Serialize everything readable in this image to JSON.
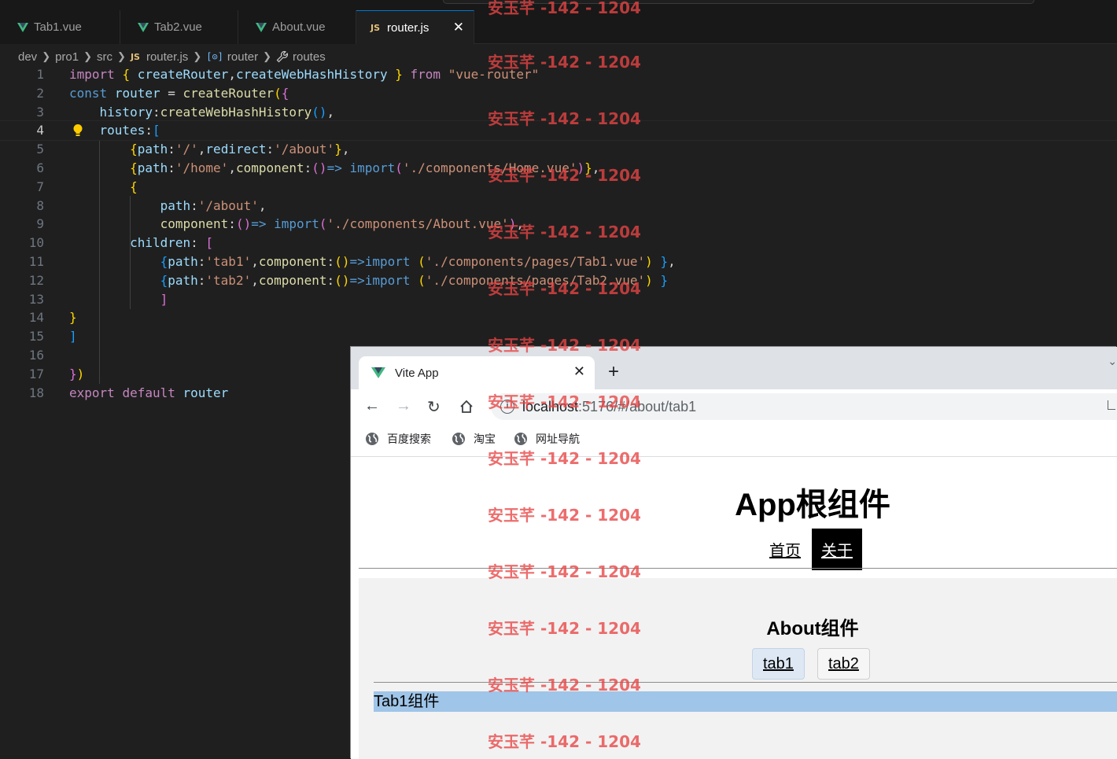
{
  "editor": {
    "tabs": [
      {
        "label": "Tab1.vue",
        "icon": "vue-icon"
      },
      {
        "label": "Tab2.vue",
        "icon": "vue-icon"
      },
      {
        "label": "About.vue",
        "icon": "vue-icon"
      },
      {
        "label": "router.js",
        "icon": "js-icon",
        "active": true
      }
    ],
    "breadcrumb": [
      "dev",
      "pro1",
      "src",
      "router.js",
      "router",
      "routes"
    ],
    "js_badge": "JS",
    "current_line": 4,
    "code_lines": [
      "1",
      "2",
      "3",
      "4",
      "5",
      "6",
      "7",
      "8",
      "9",
      "10",
      "11",
      "12",
      "13",
      "14",
      "15",
      "16",
      "17",
      "18"
    ]
  },
  "browser": {
    "tab_title": "Vite App",
    "url_host": "localhost",
    "url_rest": ":5176/#/about/tab1",
    "bookmarks": [
      "百度搜索",
      "淘宝",
      "网址导航"
    ],
    "page": {
      "title": "App根组件",
      "nav": [
        "首页",
        "关于"
      ],
      "about_title": "About组件",
      "tab_buttons": [
        "tab1",
        "tab2"
      ],
      "tab_content": "Tab1组件"
    }
  },
  "watermark": "安玉芊 -142 - 1204",
  "colors": {
    "keyword": "#c586c0",
    "variable": "#9cdcfe",
    "function": "#dcdcaa",
    "string": "#ce9178",
    "accent": "#0078d4",
    "tab_highlight": "#9fc5e8"
  }
}
